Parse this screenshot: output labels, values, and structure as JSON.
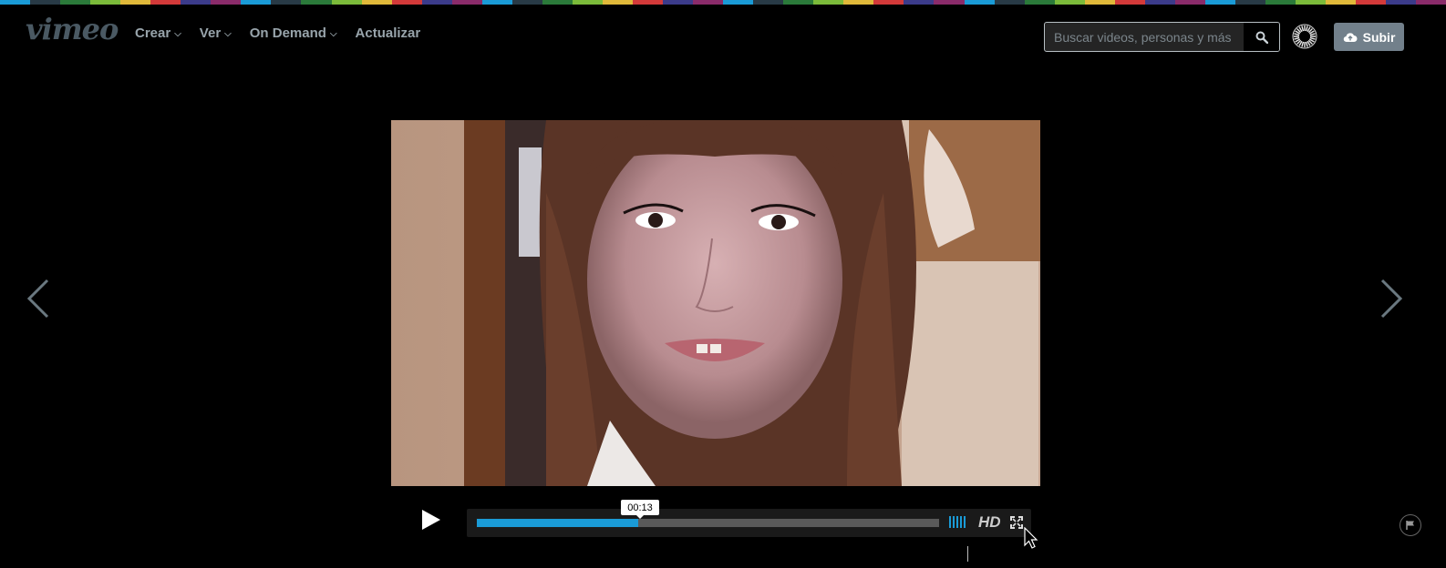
{
  "header": {
    "logo": "vimeo",
    "nav": [
      {
        "label": "Crear",
        "has_dropdown": true
      },
      {
        "label": "Ver",
        "has_dropdown": true
      },
      {
        "label": "On Demand",
        "has_dropdown": true
      },
      {
        "label": "Actualizar",
        "has_dropdown": false
      }
    ],
    "search": {
      "placeholder": "Buscar videos, personas y más",
      "value": "",
      "icon": "search-icon"
    },
    "avatar_icon": "avatar-sunburst-icon",
    "upload_label": "Subir",
    "upload_icon": "cloud-upload-icon"
  },
  "player": {
    "current_time": "00:13",
    "progress": 0.35,
    "volume_bars": 5,
    "hd_label": "HD",
    "play_icon": "play-icon",
    "fullscreen_icon": "fullscreen-icon",
    "flag_icon": "flag-icon"
  },
  "navigation": {
    "prev_icon": "chevron-left-icon",
    "next_icon": "chevron-right-icon"
  },
  "colors": {
    "accent": "#1a9bd7",
    "upload_button": "#72808b",
    "nav_text": "#98a4ab",
    "rainbow": [
      "#1a9bd7",
      "#283a46",
      "#2b7a3a",
      "#7bbb3a",
      "#e0b93a",
      "#d33a3a",
      "#3b3b8a",
      "#8a2b6a"
    ]
  }
}
